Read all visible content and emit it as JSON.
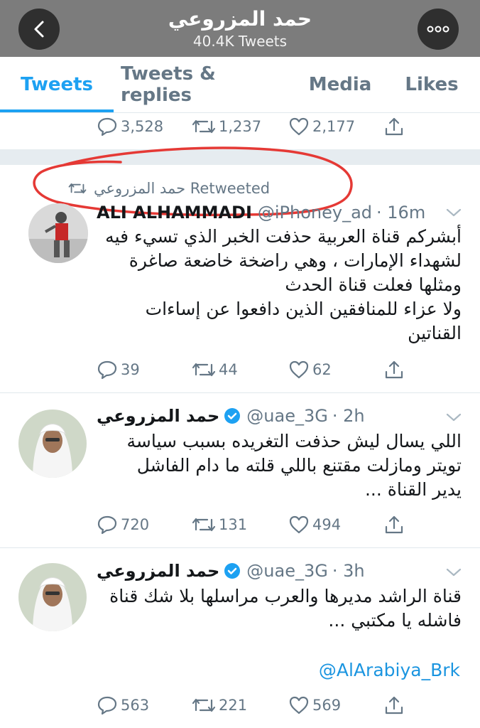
{
  "header": {
    "title": "حمد المزروعي",
    "tweet_count": "40.4K Tweets"
  },
  "tabs": [
    {
      "label": "Tweets",
      "active": true
    },
    {
      "label": "Tweets & replies"
    },
    {
      "label": "Media"
    },
    {
      "label": "Likes"
    }
  ],
  "top_actions": {
    "replies": "3,528",
    "retweets": "1,237",
    "likes": "2,177"
  },
  "retweet_context": "حمد المزروعي Retweeted",
  "tweets": [
    {
      "name": "ALI ALHAMMADI",
      "handle": "@iPhoney_ad",
      "time": "· 16m",
      "text": "أبشركم قناة العربية حذفت الخبر الذي تسيء فيه\nلشهداء الإمارات ، وهي راضخة  خاضعة صاغرة\nومثلها فعلت قناة الحدث\nولا عزاء للمنافقين الذين دافعوا عن إساءات\nالقناتين",
      "replies": "39",
      "retweets": "44",
      "likes": "62"
    },
    {
      "name": "حمد المزروعي",
      "handle": "@uae_3G",
      "time": "· 2h",
      "verified": true,
      "text": "اللي يسال ليش حذفت التغريده بسبب سياسة\nتويتر  ومازلت مقتنع باللي قلته ما دام الفاشل\nيدير القناة ...",
      "replies": "720",
      "retweets": "131",
      "likes": "494"
    },
    {
      "name": "حمد المزروعي",
      "handle": "@uae_3G",
      "time": "· 3h",
      "verified": true,
      "text": "قناة الراشد مديرها  والعرب مراسلها بلا شك قناة\nفاشله يا مكتبي ...",
      "link": "@AlArabiya_Brk",
      "replies": "563",
      "retweets": "221",
      "likes": "569"
    }
  ],
  "colors": {
    "accent": "#1da1f2",
    "muted": "#657786",
    "header_bg": "#7c7c7c",
    "annotation": "#e53935"
  }
}
